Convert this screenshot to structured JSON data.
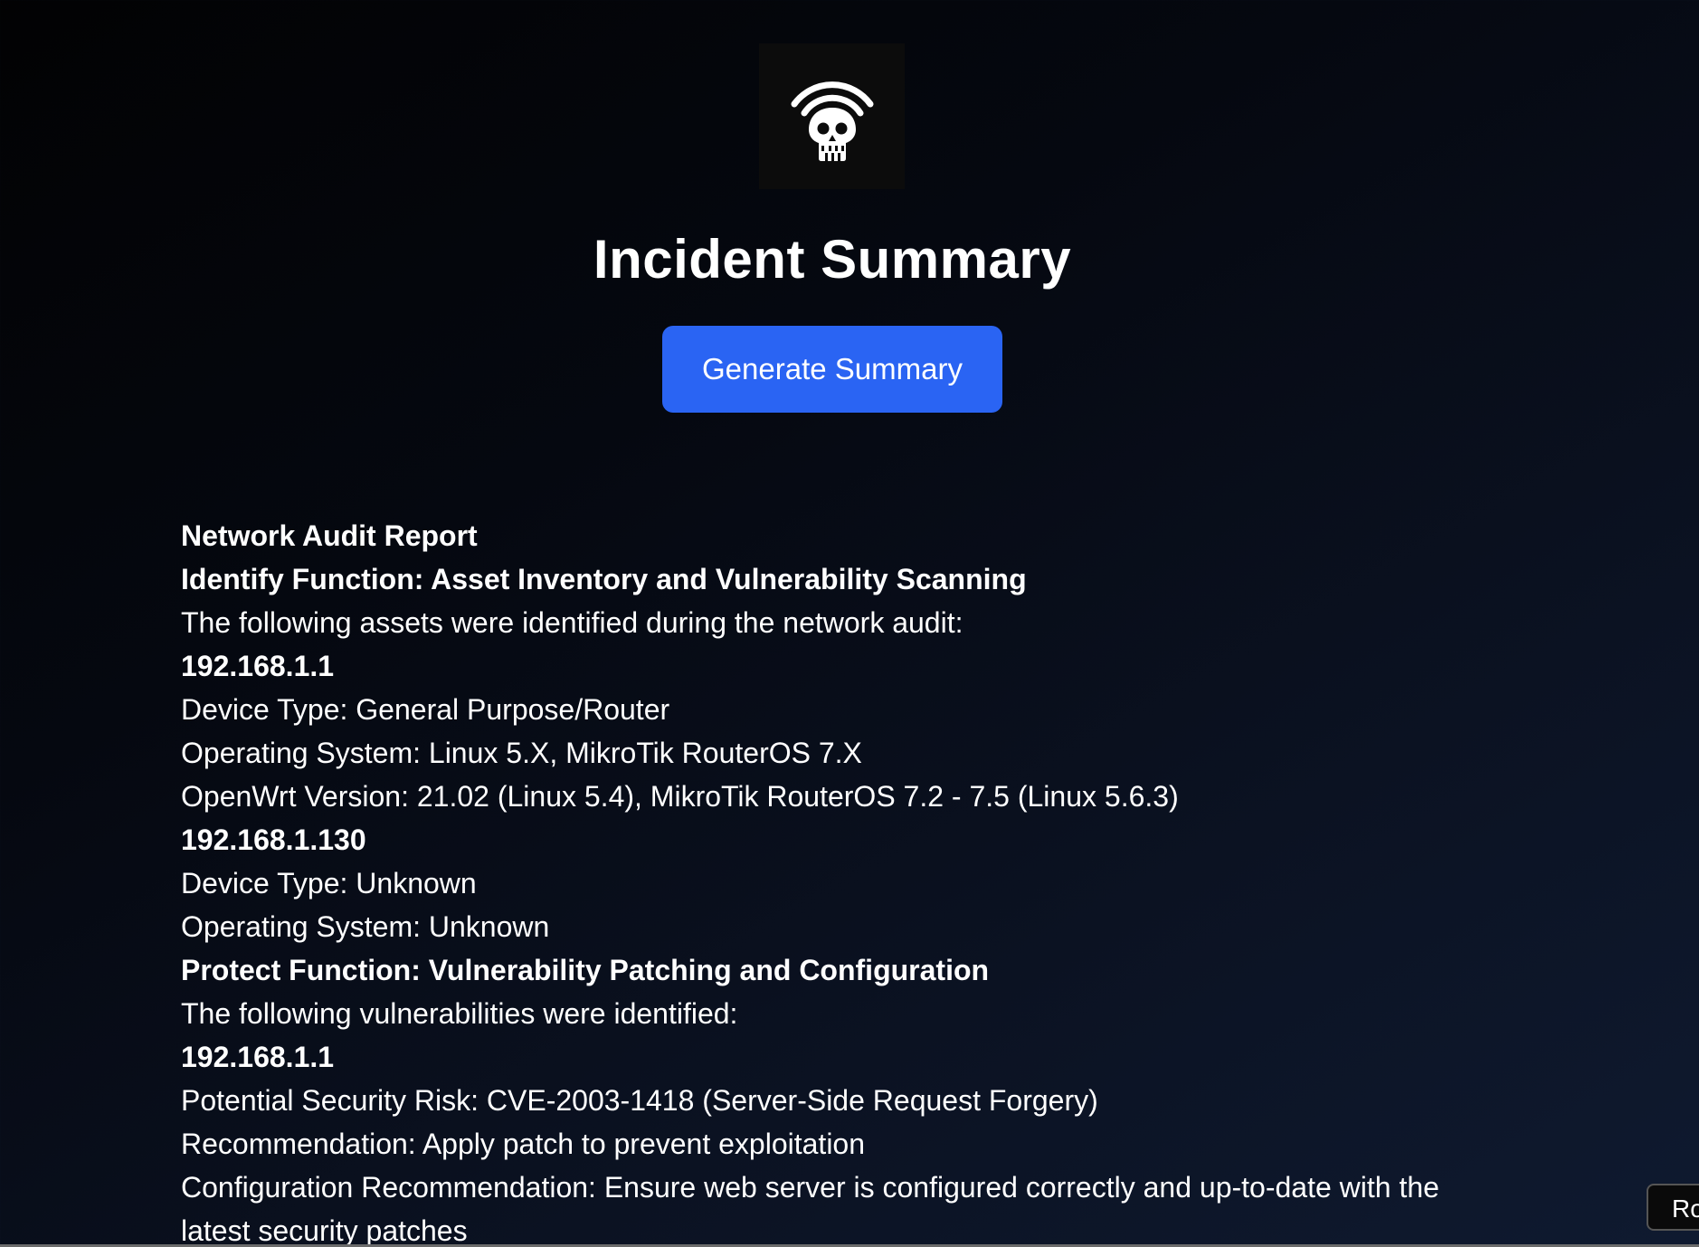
{
  "header": {
    "logo_icon": "wifi-skull-icon",
    "title": "Incident Summary",
    "button_label": "Generate Summary",
    "button_color": "#2a64f3"
  },
  "report": {
    "title": "Network Audit Report",
    "identify_heading": "Identify Function: Asset Inventory and Vulnerability Scanning",
    "identify_intro": "The following assets were identified during the network audit:",
    "asset1_ip": "192.168.1.1",
    "asset1_device": "Device Type: General Purpose/Router",
    "asset1_os": "Operating System: Linux 5.X, MikroTik RouterOS 7.X",
    "asset1_version": "OpenWrt Version: 21.02 (Linux 5.4), MikroTik RouterOS 7.2 - 7.5 (Linux 5.6.3)",
    "asset2_ip": "192.168.1.130",
    "asset2_device": "Device Type: Unknown",
    "asset2_os": "Operating System: Unknown",
    "protect_heading": "Protect Function: Vulnerability Patching and Configuration",
    "protect_intro": "The following vulnerabilities were identified:",
    "vuln1_ip": "192.168.1.1",
    "vuln1_risk": "Potential Security Risk: CVE-2003-1418 (Server-Side Request Forgery)",
    "vuln1_recommendation": "Recommendation: Apply patch to prevent exploitation",
    "vuln1_config": "Configuration Recommendation: Ensure web server is configured correctly and up-to-date with the latest security patches"
  },
  "corner_button": {
    "label": "Ro"
  }
}
